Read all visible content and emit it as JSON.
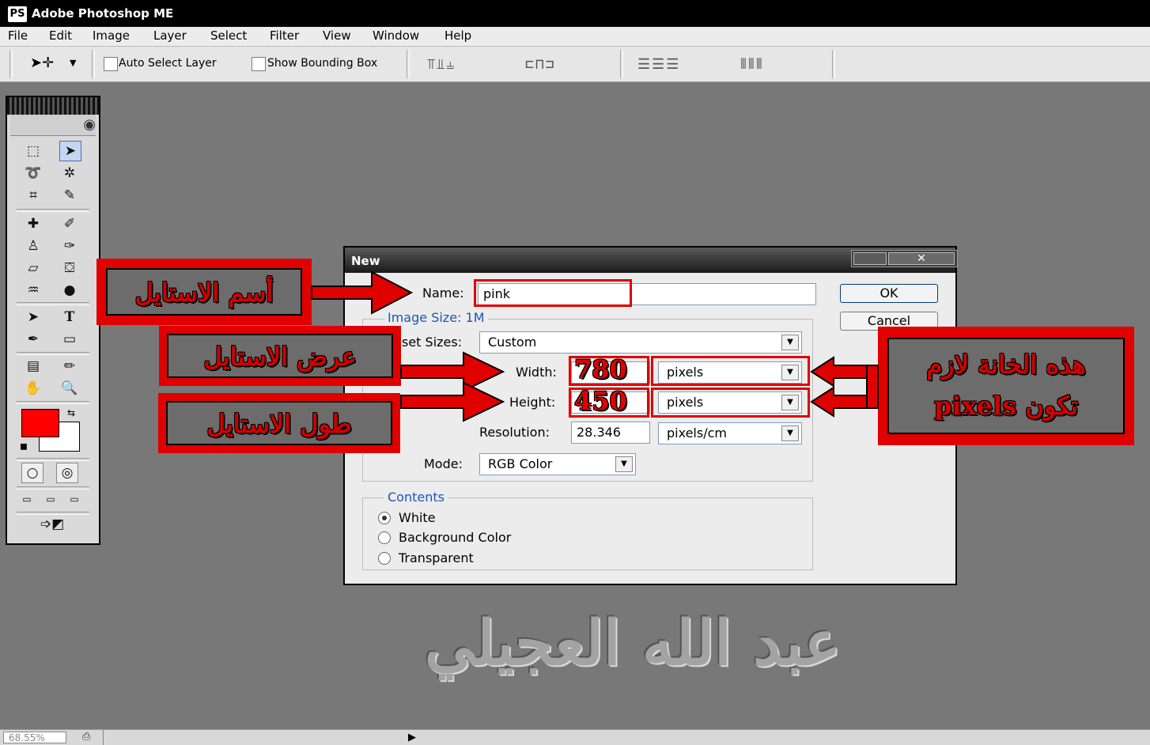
{
  "app": {
    "title": "Adobe Photoshop ME",
    "logo": "PS"
  },
  "menu": [
    "File",
    "Edit",
    "Image",
    "Layer",
    "Select",
    "Filter",
    "View",
    "Window",
    "Help"
  ],
  "options": {
    "auto_select_layer": "Auto Select Layer",
    "show_bounding_box": "Show Bounding Box"
  },
  "dialog": {
    "title": "New",
    "close_glyph": "✕",
    "name_label": "Name:",
    "name_value": "pink",
    "image_size_label": "Image Size: 1M",
    "preset_label": "set Sizes:",
    "preset_value": "Custom",
    "width_label": "Width:",
    "width_value": "780",
    "width_unit": "pixels",
    "height_label": "Height:",
    "height_value": "450",
    "height_unit": "pixels",
    "resolution_label": "Resolution:",
    "resolution_value": "28.346",
    "resolution_unit": "pixels/cm",
    "mode_label": "Mode:",
    "mode_value": "RGB Color",
    "ok": "OK",
    "cancel": "Cancel",
    "contents_label": "Contents",
    "contents_options": [
      "White",
      "Background Color",
      "Transparent"
    ],
    "contents_selected": "White"
  },
  "annotations": {
    "name_callout": "أسم الاستايل",
    "width_callout": "عرض الاستايل",
    "height_callout": "طول الاستايل",
    "units_callout_line1": "هذه الخانة لازم",
    "units_callout_line2": "تكون pixels"
  },
  "signature": "عبد الله العجيلي",
  "status": {
    "zoom": "68.55%"
  },
  "colors": {
    "foreground": "#ff0000",
    "background": "#ffffff",
    "annotation": "#e00000"
  },
  "icons": [
    "move-tool-icon",
    "marquee-icon",
    "lasso-icon",
    "magic-wand-icon",
    "crop-icon",
    "slice-icon",
    "healing-brush-icon",
    "brush-icon",
    "stamp-icon",
    "history-brush-icon",
    "eraser-icon",
    "paint-bucket-icon",
    "blur-icon",
    "dodge-icon",
    "path-selection-icon",
    "type-icon",
    "pen-icon",
    "shape-icon",
    "notes-icon",
    "eyedropper-icon",
    "hand-icon",
    "zoom-icon"
  ]
}
